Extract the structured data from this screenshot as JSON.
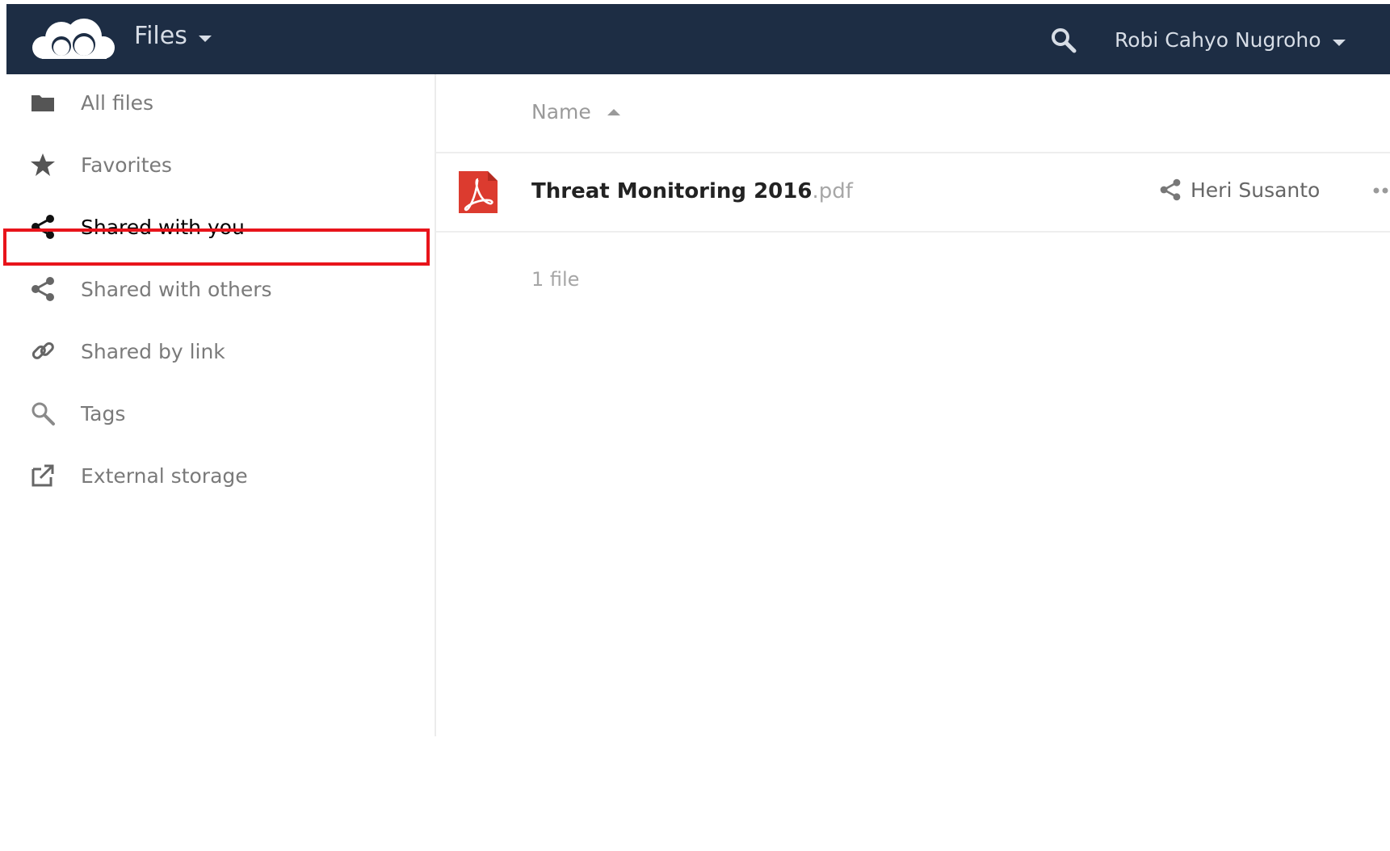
{
  "header": {
    "app_name": "Files",
    "user_name": "Robi Cahyo Nugroho",
    "bg_color": "#1d2d44",
    "logo_icon": "cloud-logo-icon",
    "search_icon": "search-icon"
  },
  "sidebar": {
    "items": [
      {
        "label": "All files",
        "icon": "folder-icon",
        "active": false
      },
      {
        "label": "Favorites",
        "icon": "star-icon",
        "active": false
      },
      {
        "label": "Shared with you",
        "icon": "share-icon",
        "active": true
      },
      {
        "label": "Shared with others",
        "icon": "share-icon",
        "active": false
      },
      {
        "label": "Shared by link",
        "icon": "link-icon",
        "active": false
      },
      {
        "label": "Tags",
        "icon": "search-icon",
        "active": false
      },
      {
        "label": "External storage",
        "icon": "external-icon",
        "active": false
      }
    ],
    "highlight_color": "#e8141b"
  },
  "main": {
    "sort_column": "Name",
    "files": [
      {
        "basename": "Threat Monitoring 2016",
        "extension": ".pdf",
        "icon": "pdf-icon",
        "shared_by": "Heri Susanto"
      }
    ],
    "summary": "1 file"
  }
}
